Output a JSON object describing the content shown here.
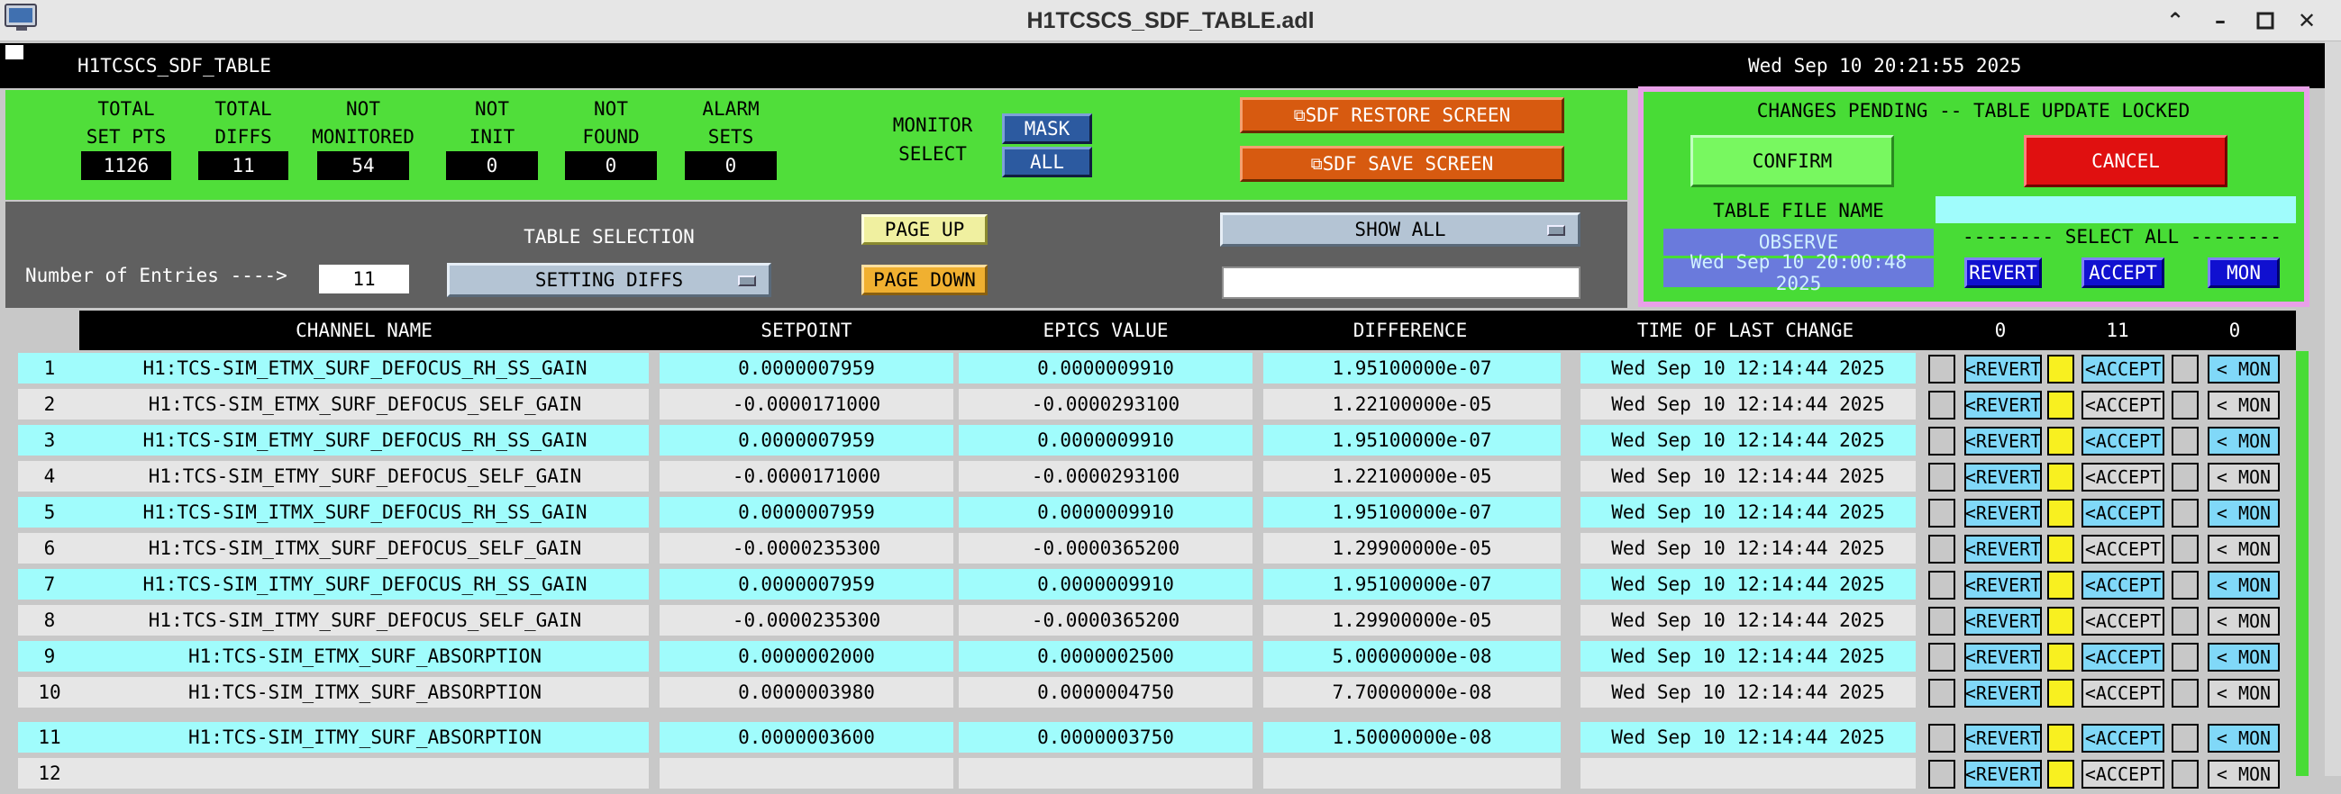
{
  "window": {
    "title": "H1TCSCS_SDF_TABLE.adl"
  },
  "header": {
    "title": "H1TCSCS_SDF_TABLE",
    "timestamp": "Wed Sep 10 20:21:55 2025"
  },
  "stats": [
    {
      "label1": "TOTAL",
      "label2": "SET PTS",
      "value": "1126"
    },
    {
      "label1": "TOTAL",
      "label2": "DIFFS",
      "value": "11"
    },
    {
      "label1": "NOT",
      "label2": "MONITORED",
      "value": "54"
    },
    {
      "label1": "NOT",
      "label2": "INIT",
      "value": "0"
    },
    {
      "label1": "NOT",
      "label2": "FOUND",
      "value": "0"
    },
    {
      "label1": "ALARM",
      "label2": "SETS",
      "value": "0"
    }
  ],
  "monitor_select": {
    "label1": "MONITOR",
    "label2": "SELECT",
    "mask": "MASK",
    "all": "ALL"
  },
  "screens": {
    "restore": "SDF RESTORE SCREEN",
    "save": "SDF SAVE SCREEN"
  },
  "controls": {
    "entries_label": "Number of Entries ---->",
    "entries_value": "11",
    "table_selection_label": "TABLE SELECTION",
    "table_selection_value": "SETTING DIFFS",
    "page_up": "PAGE UP",
    "page_down": "PAGE DOWN",
    "show_all": "SHOW ALL",
    "filter_value": ""
  },
  "pending": {
    "banner": "CHANGES PENDING -- TABLE UPDATE LOCKED",
    "confirm": "CONFIRM",
    "cancel": "CANCEL",
    "file_name_label": "TABLE FILE NAME",
    "file_name": "OBSERVE",
    "file_time": "Wed Sep 10 20:00:48 2025",
    "select_all_label": "-------- SELECT ALL --------",
    "revert": "REVERT",
    "accept": "ACCEPT",
    "mon": "MON"
  },
  "colors": {
    "green_panel": "#50de3a",
    "cyan_row": "#a0fcfc",
    "gray_row": "#e6e6e6",
    "border_pink": "#e8a0e8"
  },
  "table": {
    "headers": {
      "channel": "CHANNEL NAME",
      "setpoint": "SETPOINT",
      "epics": "EPICS VALUE",
      "difference": "DIFFERENCE",
      "time": "TIME OF LAST CHANGE",
      "count_revert": "0",
      "count_accept": "11",
      "count_mon": "0"
    },
    "row_button_labels": {
      "revert": "<REVERT",
      "accept": "<ACCEPT",
      "mon": "< MON"
    },
    "rows": [
      {
        "num": "1",
        "name": "H1:TCS-SIM_ETMX_SURF_DEFOCUS_RH_SS_GAIN",
        "setpoint": "0.0000007959",
        "epics": "0.0000009910",
        "diff": "1.95100000e-07",
        "time": "Wed Sep 10 12:14:44 2025",
        "style": "cyan"
      },
      {
        "num": "2",
        "name": "H1:TCS-SIM_ETMX_SURF_DEFOCUS_SELF_GAIN",
        "setpoint": "-0.0000171000",
        "epics": "-0.0000293100",
        "diff": "1.22100000e-05",
        "time": "Wed Sep 10 12:14:44 2025",
        "style": "gray"
      },
      {
        "num": "3",
        "name": "H1:TCS-SIM_ETMY_SURF_DEFOCUS_RH_SS_GAIN",
        "setpoint": "0.0000007959",
        "epics": "0.0000009910",
        "diff": "1.95100000e-07",
        "time": "Wed Sep 10 12:14:44 2025",
        "style": "cyan"
      },
      {
        "num": "4",
        "name": "H1:TCS-SIM_ETMY_SURF_DEFOCUS_SELF_GAIN",
        "setpoint": "-0.0000171000",
        "epics": "-0.0000293100",
        "diff": "1.22100000e-05",
        "time": "Wed Sep 10 12:14:44 2025",
        "style": "gray"
      },
      {
        "num": "5",
        "name": "H1:TCS-SIM_ITMX_SURF_DEFOCUS_RH_SS_GAIN",
        "setpoint": "0.0000007959",
        "epics": "0.0000009910",
        "diff": "1.95100000e-07",
        "time": "Wed Sep 10 12:14:44 2025",
        "style": "cyan"
      },
      {
        "num": "6",
        "name": "H1:TCS-SIM_ITMX_SURF_DEFOCUS_SELF_GAIN",
        "setpoint": "-0.0000235300",
        "epics": "-0.0000365200",
        "diff": "1.29900000e-05",
        "time": "Wed Sep 10 12:14:44 2025",
        "style": "gray"
      },
      {
        "num": "7",
        "name": "H1:TCS-SIM_ITMY_SURF_DEFOCUS_RH_SS_GAIN",
        "setpoint": "0.0000007959",
        "epics": "0.0000009910",
        "diff": "1.95100000e-07",
        "time": "Wed Sep 10 12:14:44 2025",
        "style": "cyan"
      },
      {
        "num": "8",
        "name": "H1:TCS-SIM_ITMY_SURF_DEFOCUS_SELF_GAIN",
        "setpoint": "-0.0000235300",
        "epics": "-0.0000365200",
        "diff": "1.29900000e-05",
        "time": "Wed Sep 10 12:14:44 2025",
        "style": "gray"
      },
      {
        "num": "9",
        "name": "H1:TCS-SIM_ETMX_SURF_ABSORPTION",
        "setpoint": "0.0000002000",
        "epics": "0.0000002500",
        "diff": "5.00000000e-08",
        "time": "Wed Sep 10 12:14:44 2025",
        "style": "cyan"
      },
      {
        "num": "10",
        "name": "H1:TCS-SIM_ITMX_SURF_ABSORPTION",
        "setpoint": "0.0000003980",
        "epics": "0.0000004750",
        "diff": "7.70000000e-08",
        "time": "Wed Sep 10 12:14:44 2025",
        "style": "gray"
      },
      {
        "num": "11",
        "name": "H1:TCS-SIM_ITMY_SURF_ABSORPTION",
        "setpoint": "0.0000003600",
        "epics": "0.0000003750",
        "diff": "1.50000000e-08",
        "time": "Wed Sep 10 12:14:44 2025",
        "style": "cyan"
      },
      {
        "num": "12",
        "name": "",
        "setpoint": "",
        "epics": "",
        "diff": "",
        "time": "",
        "style": "gray"
      }
    ]
  }
}
